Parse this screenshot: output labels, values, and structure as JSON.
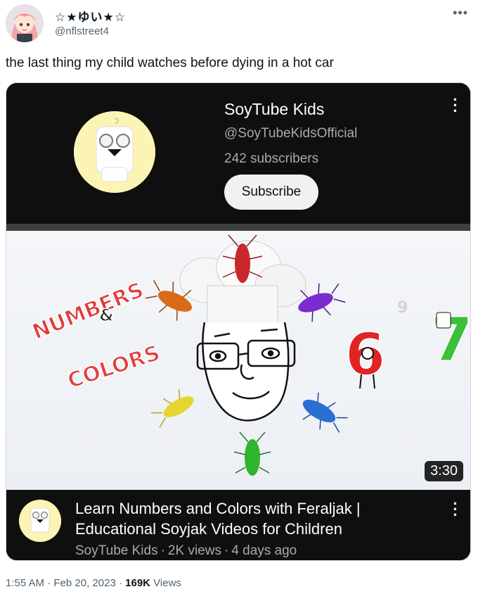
{
  "user": {
    "display_name": "☆★ゆい★☆",
    "handle": "@nflstreet4"
  },
  "icons": {
    "more": "more-horizontal-icon",
    "kebab": "more-vertical-icon"
  },
  "tweet": {
    "text": "the last thing my child watches before dying in a hot car",
    "time": "1:55 AM",
    "date": "Feb 20, 2023",
    "views_count": "169K",
    "views_label": "Views"
  },
  "channel": {
    "name": "SoyTube Kids",
    "handle": "@SoyTubeKidsOfficial",
    "subscribers": "242 subscribers",
    "subscribe_label": "Subscribe"
  },
  "thumbnail": {
    "duration": "3:30",
    "title_art": [
      "NUMBERS",
      "&",
      "COLORS"
    ],
    "digits": [
      "6",
      "7",
      "9"
    ]
  },
  "video": {
    "title": "Learn Numbers and Colors with Feraljak | Educational Soyjak Videos for Children",
    "channel": "SoyTube Kids",
    "views": "2K views",
    "age": "4 days ago",
    "separator": "·"
  },
  "colors": {
    "youtube_dark": "#0f0f0f",
    "muted_text": "#aaaaaa",
    "twitter_gray": "#536471",
    "avatar_yellow": "#fbf4b5"
  }
}
